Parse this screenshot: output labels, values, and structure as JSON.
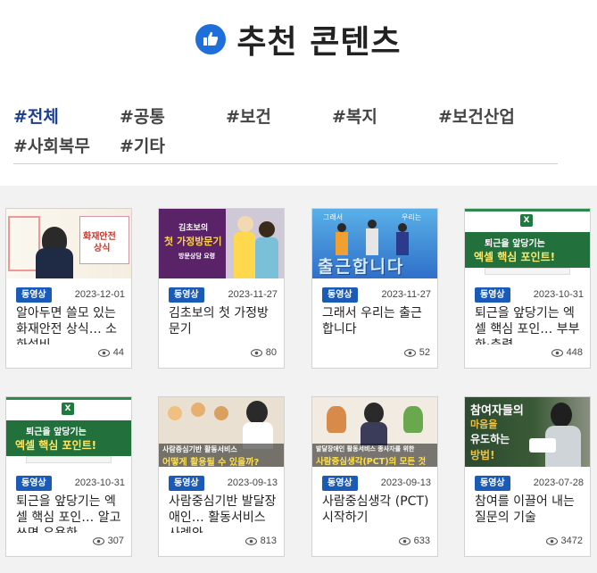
{
  "header": {
    "title": "추천 콘텐츠",
    "icon": "thumbs-up-icon",
    "accent": "#1e6fd9"
  },
  "tags": [
    {
      "label": "#전체",
      "active": true
    },
    {
      "label": "#공통",
      "active": false
    },
    {
      "label": "#보건",
      "active": false
    },
    {
      "label": "#복지",
      "active": false
    },
    {
      "label": "#보건산업",
      "active": false
    },
    {
      "label": "#사회복무",
      "active": false
    },
    {
      "label": "#기타",
      "active": false
    }
  ],
  "cards": [
    {
      "badge": "동영상",
      "date": "2023-12-01",
      "title": "알아두면 쓸모 있는 화재안전 상식… 소화설비",
      "views": "44",
      "thumb_text": [
        "화재안전",
        "상식"
      ]
    },
    {
      "badge": "동영상",
      "date": "2023-11-27",
      "title": "김초보의 첫 가정방문기",
      "views": "80",
      "thumb_text": [
        "김초보의",
        "첫 가정방문기",
        "방문상담 요령"
      ]
    },
    {
      "badge": "동영상",
      "date": "2023-11-27",
      "title": "그래서 우리는 출근합니다",
      "views": "52",
      "thumb_text": [
        "그래서",
        "우리는",
        "출근합니다"
      ]
    },
    {
      "badge": "동영상",
      "date": "2023-10-31",
      "title": "퇴근을 앞당기는 엑셀 핵심 포인… 부부한·측렴",
      "views": "448",
      "thumb_text": [
        "퇴근을 앞당기는",
        "엑셀 핵심 포인트!"
      ]
    },
    {
      "badge": "동영상",
      "date": "2023-10-31",
      "title": "퇴근을 앞당기는 엑셀 핵심 포인… 알고 쓰면 유용한",
      "views": "307",
      "thumb_text": [
        "퇴근을 앞당기는",
        "엑셀 핵심 포인트!"
      ]
    },
    {
      "badge": "동영상",
      "date": "2023-09-13",
      "title": "사람중심기반 발달장애인… 활동서비스 사례와",
      "views": "813",
      "thumb_text": [
        "사람중심기반 활동서비스",
        "어떻게 활용될 수 있을까?"
      ]
    },
    {
      "badge": "동영상",
      "date": "2023-09-13",
      "title": "사람중심생각 (PCT) 시작하기",
      "views": "633",
      "thumb_text": [
        "발달장애인 활동서비스 종사자를 위한",
        "사람중심생각(PCT)의 모든 것"
      ]
    },
    {
      "badge": "동영상",
      "date": "2023-07-28",
      "title": "참여를 이끌어 내는 질문의 기술",
      "views": "3472",
      "thumb_text": [
        "참여자들의",
        "마음을",
        "유도하는",
        "방법!"
      ]
    }
  ]
}
